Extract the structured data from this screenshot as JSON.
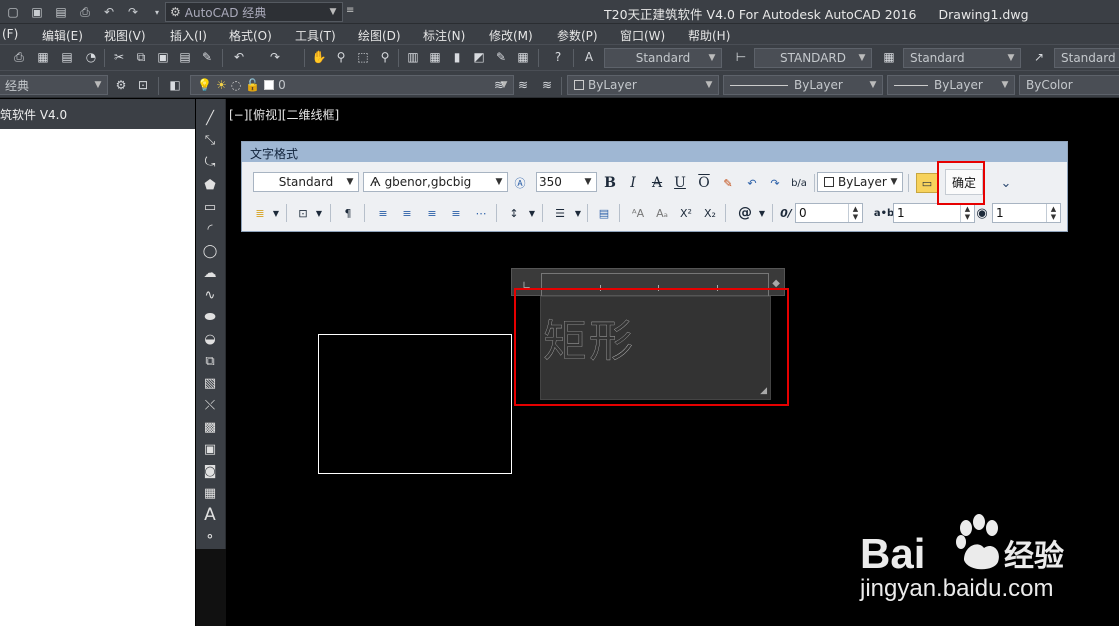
{
  "window": {
    "title": "T20天正建筑软件 V4.0 For Autodesk AutoCAD 2016",
    "document": "Drawing1.dwg",
    "workspace": "AutoCAD 经典"
  },
  "menu": [
    "(F)",
    "编辑(E)",
    "视图(V)",
    "插入(I)",
    "格式(O)",
    "工具(T)",
    "绘图(D)",
    "标注(N)",
    "修改(M)",
    "参数(P)",
    "窗口(W)",
    "帮助(H)"
  ],
  "toolbar": {
    "text_style": "Standard",
    "dim_style": "STANDARD",
    "table_style": "Standard",
    "multileader_style": "Standard",
    "workspace2": "经典",
    "layer": "0",
    "color": "ByLayer",
    "linetype": "ByLayer",
    "lineweight": "ByLayer",
    "plotstyle": "ByColor"
  },
  "panel": {
    "title": "筑软件 V4.0"
  },
  "viewport_label": "[−][俯视][二维线框]",
  "text_format": {
    "title": "文字格式",
    "style": "Standard",
    "font": "gbenor,gbcbig",
    "height": "350",
    "color": "ByLayer",
    "ok_label": "确定",
    "oblique": "0",
    "tracking": "1",
    "width_factor": "1",
    "stack_label": "b/a",
    "at_symbol": "@"
  },
  "mtext": {
    "content": "矩形"
  },
  "watermark": {
    "brand": "Bai",
    "brand2": "经验",
    "url": "jingyan.baidu.com"
  },
  "colors": {
    "highlight": "#e60000",
    "chrome": "#3b3f45",
    "textformat_title": "#9fb7d3"
  }
}
